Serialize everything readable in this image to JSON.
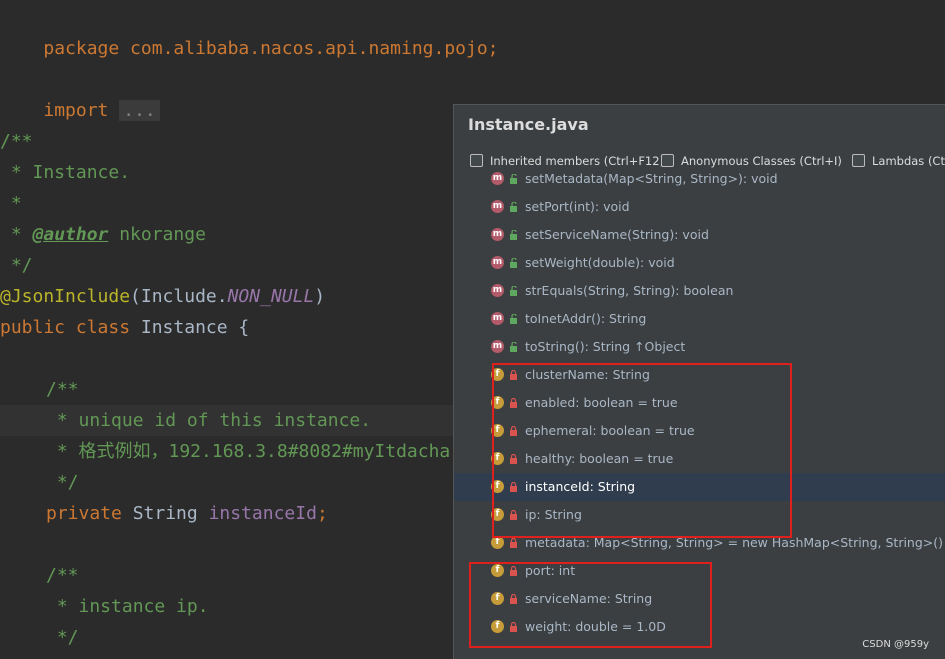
{
  "editor": {
    "lines": [
      {
        "id": "package",
        "text": "package com.alibaba.nacos.api.naming.pojo;"
      },
      {
        "id": "import",
        "kw": "import",
        "fold": "..."
      },
      {
        "id": "doc-open",
        "text": "/**"
      },
      {
        "id": "doc-instance",
        "text": " * Instance."
      },
      {
        "id": "doc-star",
        "text": " *"
      },
      {
        "id": "doc-author-tag",
        "text": "@author"
      },
      {
        "id": "doc-author-name",
        "text": " nkorange"
      },
      {
        "id": "doc-close",
        "text": " */"
      },
      {
        "id": "annotation",
        "ann": "@JsonInclude",
        "text1": "(Include.",
        "const": "NON_NULL",
        "text2": ")"
      },
      {
        "id": "class-decl",
        "kw": "public class",
        "text": " Instance {"
      },
      {
        "id": "doc2-open",
        "text": "/**"
      },
      {
        "id": "doc2-unique",
        "text": " * unique id of this instance."
      },
      {
        "id": "doc2-example",
        "text": " * 格式例如，192.168.3.8#8082#myItdacha"
      },
      {
        "id": "doc2-close",
        "text": " */"
      },
      {
        "id": "field-instanceId",
        "kw": "private",
        "type": " String ",
        "name": "instanceId",
        "end": ";"
      },
      {
        "id": "doc3-open",
        "text": "/**"
      },
      {
        "id": "doc3-ip",
        "text": " * instance ip."
      },
      {
        "id": "doc3-close",
        "text": " */"
      }
    ]
  },
  "popup": {
    "title": "Instance.java",
    "filters": {
      "inherited": "Inherited members (Ctrl+F12)",
      "anonymous": "Anonymous Classes (Ctrl+I)",
      "lambdas": "Lambdas (Ctrl+"
    },
    "members": [
      {
        "kind": "m",
        "text": "setMetadata(Map<String, String>): void"
      },
      {
        "kind": "m",
        "text": "setPort(int): void"
      },
      {
        "kind": "m",
        "text": "setServiceName(String): void"
      },
      {
        "kind": "m",
        "text": "setWeight(double): void"
      },
      {
        "kind": "m",
        "text": "strEquals(String, String): boolean"
      },
      {
        "kind": "m",
        "text": "toInetAddr(): String"
      },
      {
        "kind": "m",
        "text": "toString(): String ↑Object"
      },
      {
        "kind": "f",
        "text": "clusterName: String"
      },
      {
        "kind": "f",
        "text": "enabled: boolean = true"
      },
      {
        "kind": "f",
        "text": "ephemeral: boolean = true"
      },
      {
        "kind": "f",
        "text": "healthy: boolean = true"
      },
      {
        "kind": "f",
        "text": "instanceId: String",
        "selected": true
      },
      {
        "kind": "f",
        "text": "ip: String"
      },
      {
        "kind": "f",
        "text": "metadata: Map<String, String> = new HashMap<String, String>()"
      },
      {
        "kind": "f",
        "text": "port: int"
      },
      {
        "kind": "f",
        "text": "serviceName: String"
      },
      {
        "kind": "f",
        "text": "weight: double = 1.0D"
      }
    ]
  },
  "colors": {
    "editor_bg": "#2b2b2b",
    "popup_bg": "#3c3f41",
    "selected_row": "#2f3d4e",
    "highlight_box": "#e0201c",
    "method_badge": "#b35b6a",
    "field_badge": "#c69c3a"
  },
  "watermark": "CSDN @959y"
}
